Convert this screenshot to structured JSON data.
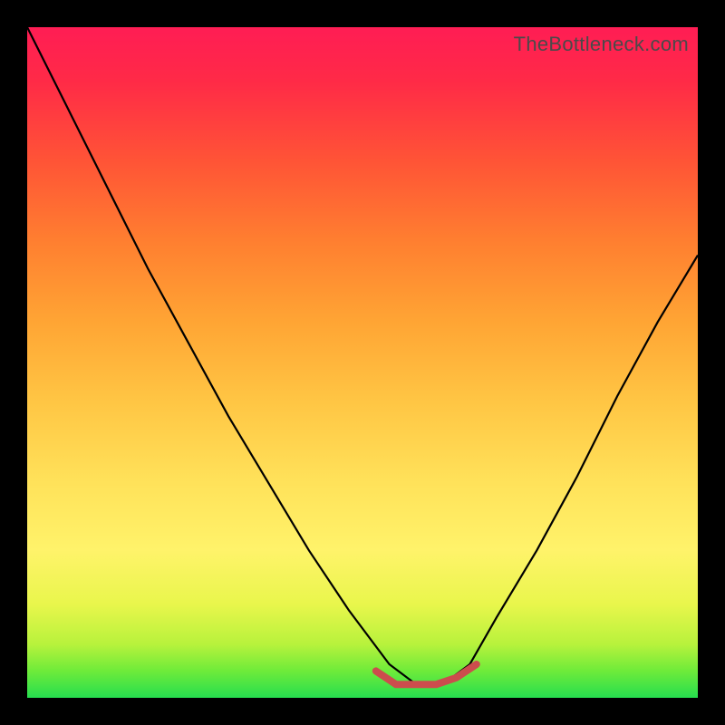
{
  "watermark": "TheBottleneck.com",
  "chart_data": {
    "type": "line",
    "title": "",
    "xlabel": "",
    "ylabel": "",
    "ylim": [
      0,
      100
    ],
    "xlim": [
      0,
      100
    ],
    "series": [
      {
        "name": "main-curve",
        "color": "#000000",
        "x": [
          0,
          6,
          12,
          18,
          24,
          30,
          36,
          42,
          48,
          54,
          58,
          62,
          66,
          70,
          76,
          82,
          88,
          94,
          100
        ],
        "values": [
          100,
          88,
          76,
          64,
          53,
          42,
          32,
          22,
          13,
          5,
          2,
          2,
          5,
          12,
          22,
          33,
          45,
          56,
          66
        ]
      },
      {
        "name": "valley-highlight",
        "color": "#cc4d4d",
        "x": [
          52,
          55,
          58,
          61,
          64,
          67
        ],
        "values": [
          4,
          2,
          2,
          2,
          3,
          5
        ]
      }
    ],
    "background_gradient": {
      "bottom": "#26de4f",
      "mid_low": "#fff36a",
      "mid_high": "#ffa534",
      "top": "#ff1d54"
    }
  }
}
